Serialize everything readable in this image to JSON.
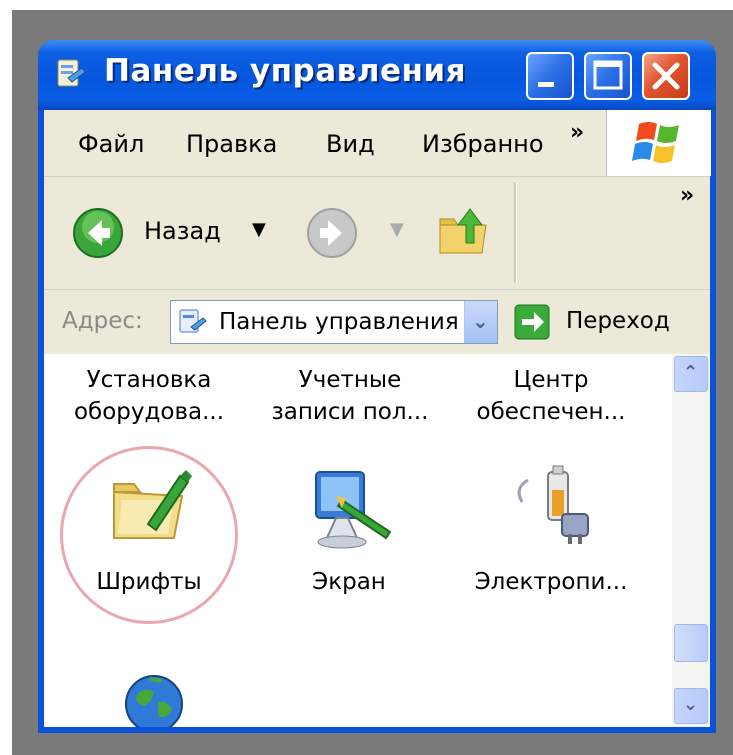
{
  "window": {
    "title": "Панель управления",
    "title_icon": "control-panel-icon",
    "buttons": {
      "minimize": "minimize-icon",
      "maximize": "maximize-icon",
      "close": "close-icon"
    }
  },
  "menubar": {
    "items": [
      {
        "label": "Файл"
      },
      {
        "label": "Правка"
      },
      {
        "label": "Вид"
      },
      {
        "label": "Избранно"
      }
    ],
    "overflow": "»"
  },
  "toolbar": {
    "back_label": "Назад",
    "dropdown_glyph": "▼",
    "overflow": "»"
  },
  "address": {
    "label": "Адрес:",
    "value": "Панель управления",
    "go_label": "Переход"
  },
  "items": [
    {
      "line1": "Установка",
      "line2": "оборудова..."
    },
    {
      "line1": "Учетные",
      "line2": "записи пол..."
    },
    {
      "line1": "Центр",
      "line2": "обеспечен..."
    },
    {
      "label": "Шрифты",
      "icon": "fonts-folder-icon"
    },
    {
      "label": "Экран",
      "icon": "display-icon"
    },
    {
      "label": "Электропи...",
      "icon": "power-options-icon"
    },
    {
      "label": "",
      "icon": "globe-icon"
    }
  ],
  "colors": {
    "titlebar": "#0556dc",
    "client_bg": "#ece9d8",
    "highlight": "#eaa7ae"
  }
}
